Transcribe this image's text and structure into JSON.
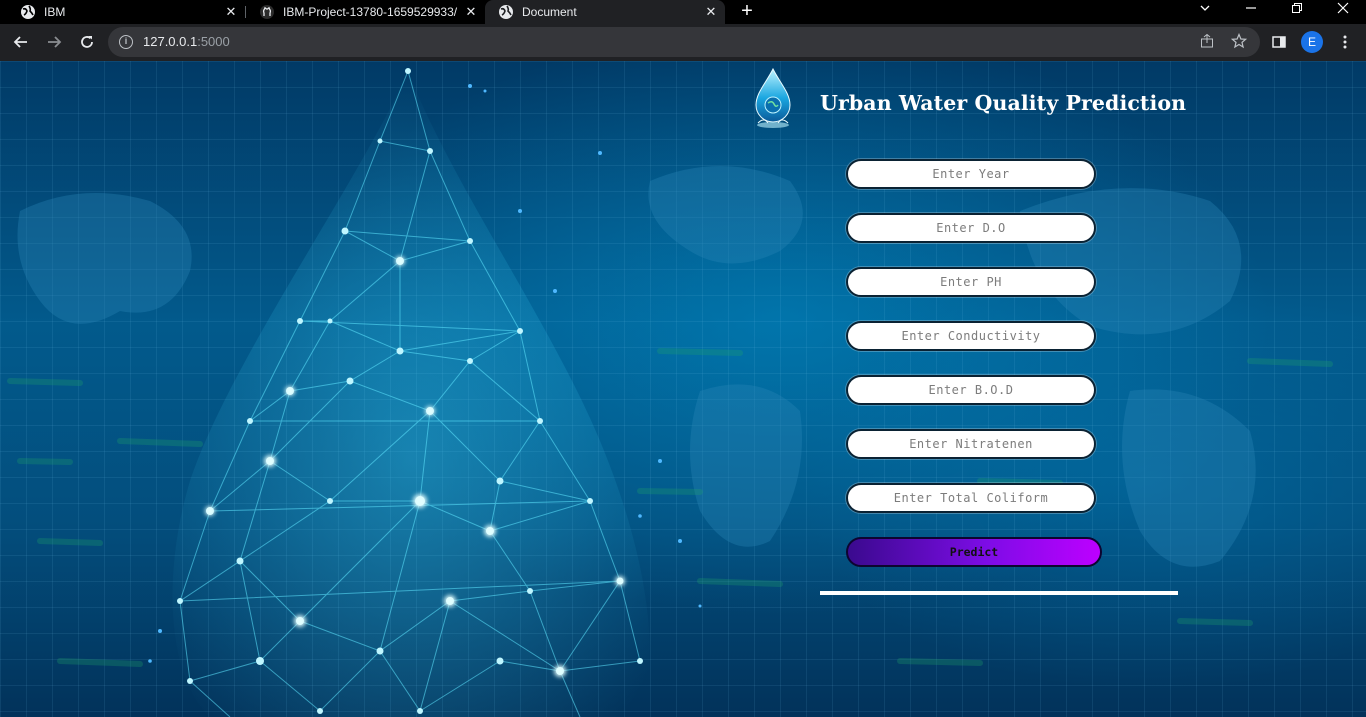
{
  "browser": {
    "tabs": [
      {
        "title": "IBM",
        "icon": "globe-icon",
        "active": false
      },
      {
        "title": "IBM-Project-13780-1659529933/",
        "icon": "github-icon",
        "active": false
      },
      {
        "title": "Document",
        "icon": "globe-icon",
        "active": true
      }
    ],
    "close_glyph": "✕",
    "new_tab_glyph": "+",
    "url_host": "127.0.0.1",
    "url_port": ":5000",
    "profile_initial": "E"
  },
  "page": {
    "title": "Urban Water Quality Prediction",
    "fields": [
      {
        "name": "year-input",
        "placeholder": "Enter Year"
      },
      {
        "name": "do-input",
        "placeholder": "Enter D.O"
      },
      {
        "name": "ph-input",
        "placeholder": "Enter PH"
      },
      {
        "name": "conductivity-input",
        "placeholder": "Enter Conductivity"
      },
      {
        "name": "bod-input",
        "placeholder": "Enter B.O.D"
      },
      {
        "name": "nitratenen-input",
        "placeholder": "Enter Nitratenen"
      },
      {
        "name": "total-coliform-input",
        "placeholder": "Enter Total Coliform"
      }
    ],
    "predict_label": "Predict",
    "colors": {
      "predict_start": "#3a0a8e",
      "predict_end": "#bd00ff",
      "background": "#025a8c"
    }
  }
}
